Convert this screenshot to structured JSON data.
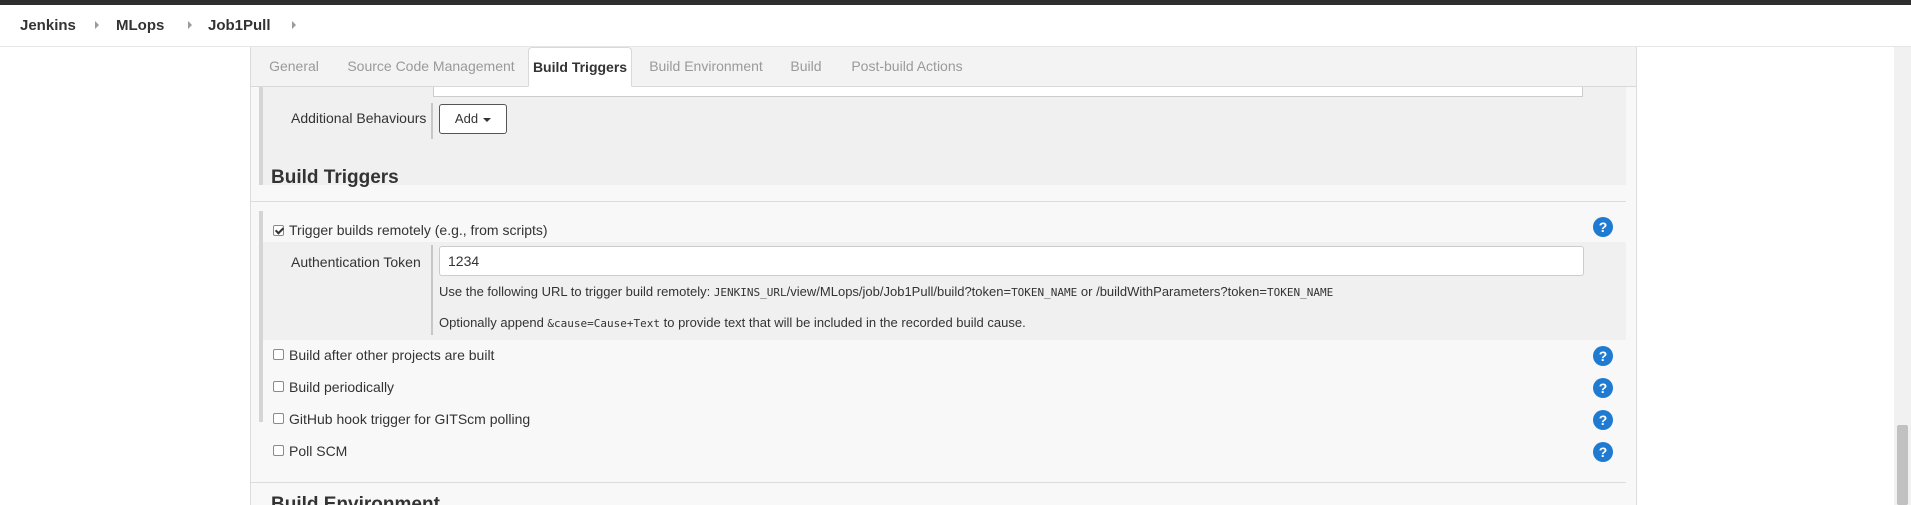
{
  "breadcrumb": {
    "items": [
      "Jenkins",
      "MLops",
      "Job1Pull"
    ]
  },
  "tabs": [
    {
      "label": "General",
      "active": false
    },
    {
      "label": "Source Code Management",
      "active": false
    },
    {
      "label": "Build Triggers",
      "active": true
    },
    {
      "label": "Build Environment",
      "active": false
    },
    {
      "label": "Build",
      "active": false
    },
    {
      "label": "Post-build Actions",
      "active": false
    }
  ],
  "scm": {
    "additional_behaviours_label": "Additional Behaviours",
    "add_button_label": "Add"
  },
  "build_triggers": {
    "heading": "Build Triggers",
    "remote": {
      "label": "Trigger builds remotely (e.g., from scripts)",
      "checked": true,
      "token_label": "Authentication Token",
      "token_value": "1234",
      "info_line1": {
        "prefix": "Use the following URL to trigger build remotely: ",
        "code1": "JENKINS_URL",
        "mid": "/view/MLops/job/Job1Pull/build?token=",
        "code2": "TOKEN_NAME",
        "mid2": " or /buildWithParameters?token=",
        "code3": "TOKEN_NAME"
      },
      "info_line2": {
        "prefix": "Optionally append ",
        "code": "&cause=Cause+Text",
        "suffix": " to provide text that will be included in the recorded build cause."
      }
    },
    "options": [
      {
        "label": "Build after other projects are built",
        "checked": false
      },
      {
        "label": "Build periodically",
        "checked": false
      },
      {
        "label": "GitHub hook trigger for GITScm polling",
        "checked": false
      },
      {
        "label": "Poll SCM",
        "checked": false
      }
    ],
    "help_icon_label": "?"
  },
  "next_section": {
    "heading": "Build Environment"
  },
  "colors": {
    "help_icon": "#1f7bd1",
    "topbar": "#2e2e2e",
    "panel_bg": "#f8f8f8"
  }
}
